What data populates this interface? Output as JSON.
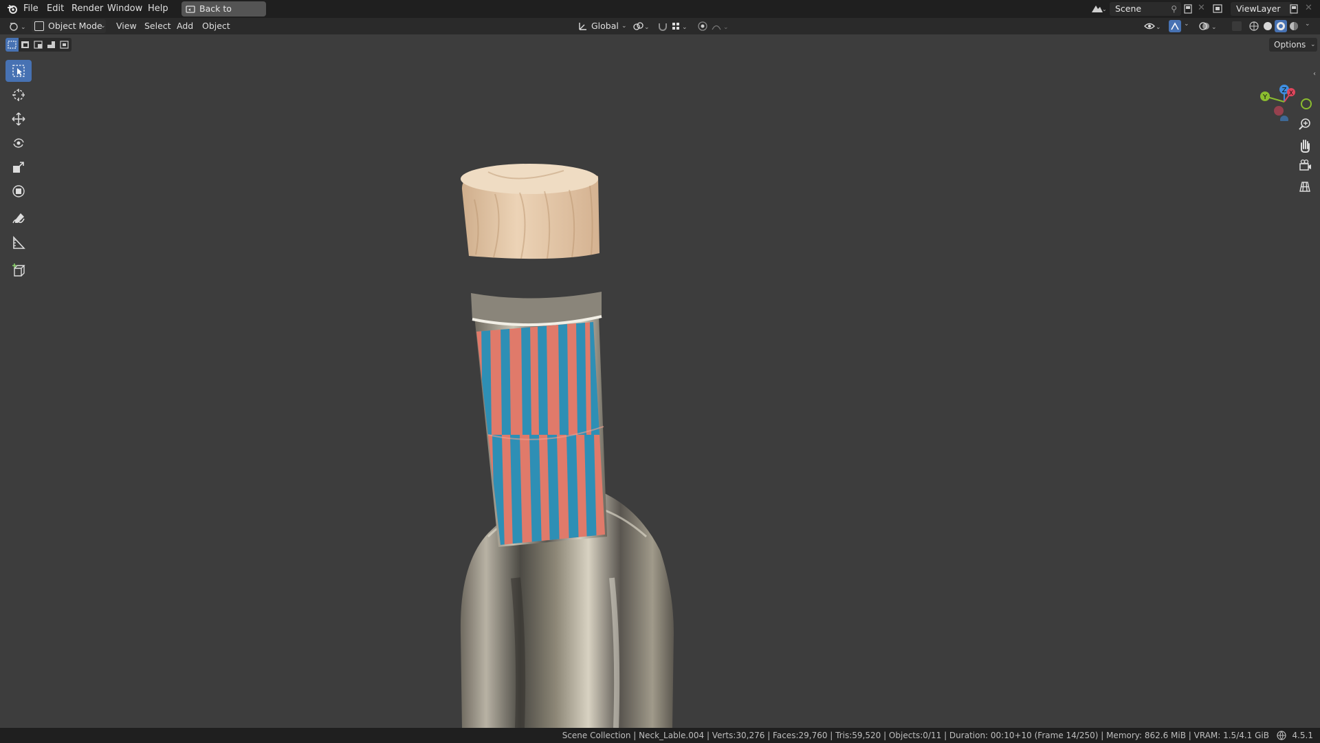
{
  "menu": {
    "file": "File",
    "edit": "Edit",
    "render": "Render",
    "window": "Window",
    "help": "Help",
    "back_to_previous": "Back to Previous"
  },
  "scene": {
    "label": "Scene"
  },
  "view_layer": {
    "label": "ViewLayer"
  },
  "header": {
    "mode": "Object Mode",
    "view": "View",
    "select": "Select",
    "add": "Add",
    "object": "Object",
    "transform_orientation": "Global",
    "options": "Options"
  },
  "gizmo": {
    "x": "X",
    "y": "Y",
    "z": "Z"
  },
  "tools": [
    "select-box",
    "cursor",
    "move",
    "rotate",
    "scale",
    "transform",
    "annotate",
    "measure",
    "add-cube"
  ],
  "status": {
    "text": "Scene Collection | Neck_Lable.004 | Verts:30,276 | Faces:29,760 | Tris:59,520 | Objects:0/11 | Duration: 00:10+10 (Frame 14/250) | Memory: 862.6 MiB | VRAM: 1.5/4.1 GiB",
    "version": "4.5.1"
  },
  "colors": {
    "accent": "#4772b3",
    "label_orange": "#e07a6a",
    "label_blue": "#2e8fb5",
    "cork": "#e6c9a8",
    "axis_x": "#e0465c",
    "axis_y": "#8bbd2f",
    "axis_z": "#3f8ee0"
  }
}
